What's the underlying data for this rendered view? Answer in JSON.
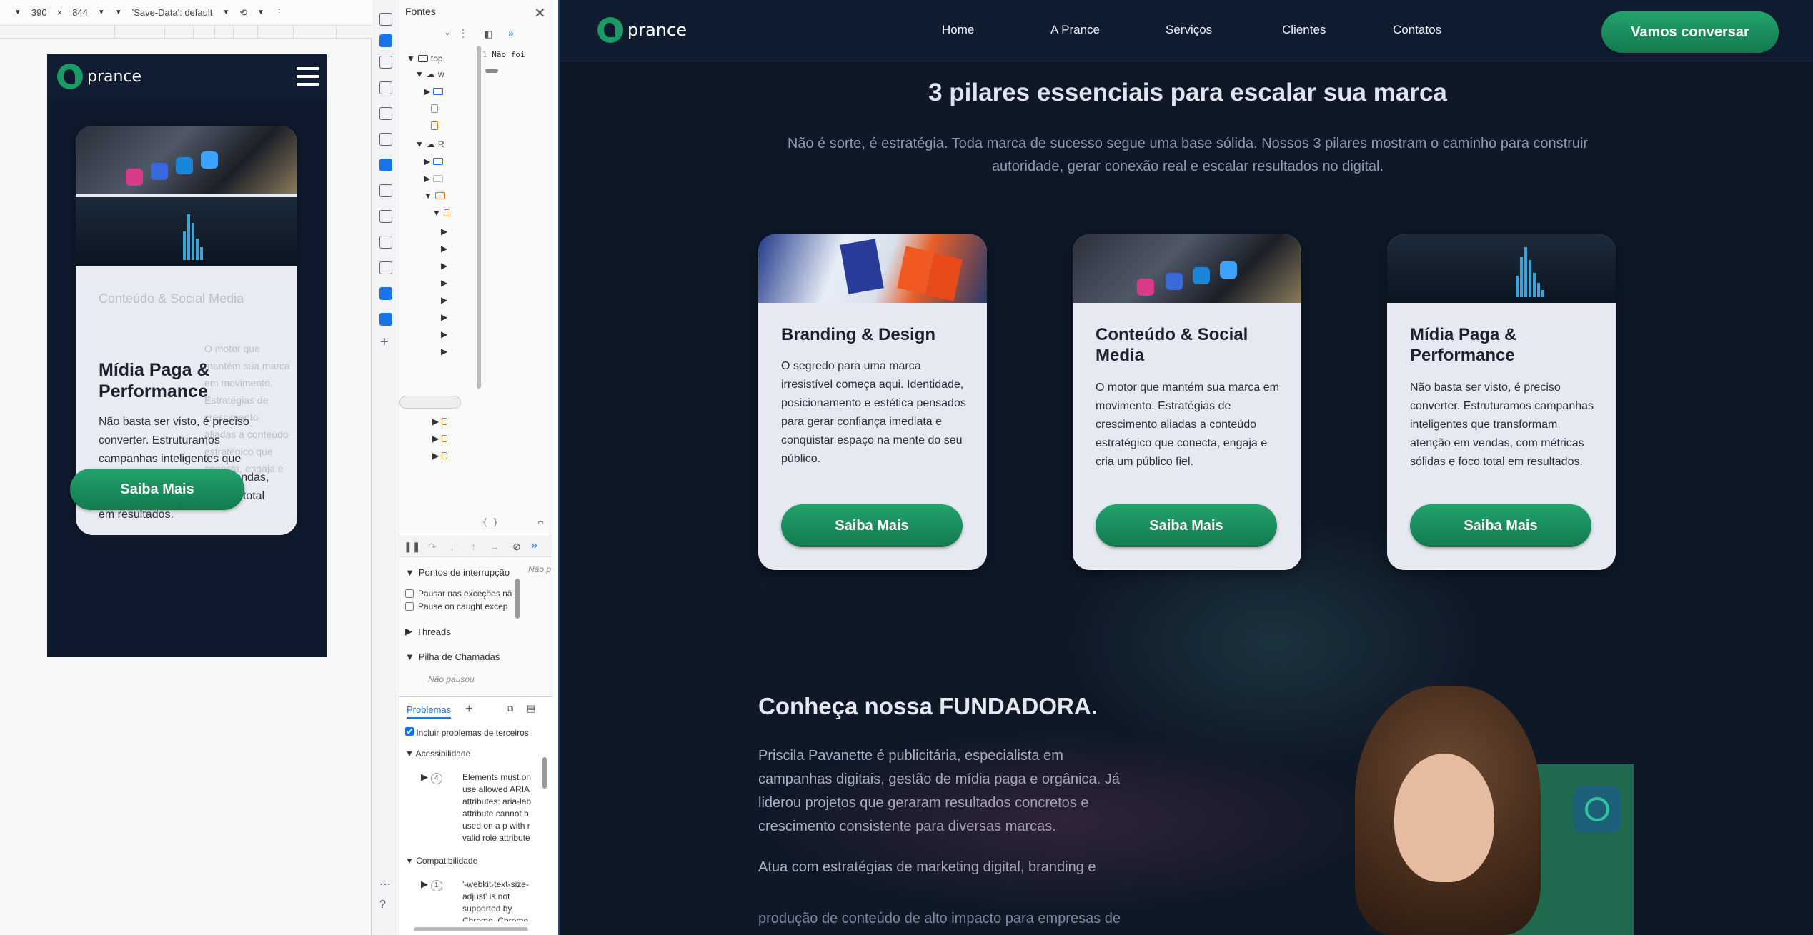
{
  "device_toolbar": {
    "width": "390",
    "times": "×",
    "height": "844",
    "save_data": "'Save-Data': default"
  },
  "mobile": {
    "logo_text": "prance",
    "card": {
      "title": "Mídia Paga & Performance",
      "text": "Não basta ser visto, é preciso converter. Estruturamos campanhas inteligentes que transformam atenção em vendas, com métricas sólidas e foco total em resultados.",
      "ghost_title": "Conteúdo & Social Media",
      "ghost_text": "O motor que mantém sua marca em movimento. Estratégias de crescimento aliadas a conteúdo estratégico que conecta, engaja e",
      "button": "Saiba Mais"
    }
  },
  "devtools": {
    "panel_title": "Fontes",
    "tree": {
      "top": "top",
      "w": "w",
      "r": "R"
    },
    "code_line_no": "1",
    "code_text": "Não foi",
    "breakpoints": "Pontos de interrupção",
    "pause_exceptions": "Pausar nas exceções nã",
    "pause_caught": "Pause on caught excep",
    "threads": "Threads",
    "call_stack": "Pilha de Chamadas",
    "not_paused": "Não pausou",
    "not_paused_side": "Não p",
    "problems_tab": "Problemas",
    "include_third_party": "Incluir problemas de terceiros",
    "accessibility": "Acessibilidade",
    "accessibility_count": "4",
    "accessibility_msg": "Elements must on use allowed ARIA attributes: aria-lab attribute cannot b used on a p with r valid role attribute",
    "compatibility": "Compatibilidade",
    "compatibility_count": "1",
    "compatibility_msg": "'-webkit-text-size-adjust' is not supported by Chrome, Chrome"
  },
  "site": {
    "logo_text": "prance",
    "nav": [
      "Home",
      "A Prance",
      "Serviços",
      "Clientes",
      "Contatos"
    ],
    "cta": "Vamos conversar",
    "section_title": "3 pilares essenciais para escalar sua marca",
    "section_subtitle": "Não é sorte, é estratégia. Toda marca de sucesso segue uma base sólida. Nossos 3 pilares mostram o caminho para construir autoridade, gerar conexão real e escalar resultados no digital.",
    "cards": [
      {
        "title": "Branding & Design",
        "text": "O segredo para uma marca irresistível começa aqui. Identidade, posicionamento e estética pensados para gerar confiança imediata e conquistar espaço na mente do seu público.",
        "button": "Saiba Mais"
      },
      {
        "title": "Conteúdo & Social Media",
        "text": "O motor que mantém sua marca em movimento. Estratégias de crescimento aliadas a conteúdo estratégico que conecta, engaja e cria um público fiel.",
        "button": "Saiba Mais"
      },
      {
        "title": "Mídia Paga & Performance",
        "text": "Não basta ser visto, é preciso converter. Estruturamos campanhas inteligentes que transformam atenção em vendas, com métricas sólidas e foco total em resultados.",
        "button": "Saiba Mais"
      }
    ],
    "founder_title": "Conheça nossa FUNDADORA.",
    "founder_text": "Priscila Pavanette é publicitária, especialista em campanhas digitais, gestão de mídia paga e orgânica. Já liderou projetos que geraram resultados concretos e crescimento consistente para diversas marcas.",
    "founder_text2": "Atua com estratégias de marketing digital, branding e",
    "founder_text3": "produção de conteúdo de alto impacto para empresas de"
  },
  "colors": {
    "site_bg": "#0e1827",
    "nav_bg": "#101d31",
    "accent_green": "#1a9b66",
    "card_bg": "#e6e9f1"
  }
}
